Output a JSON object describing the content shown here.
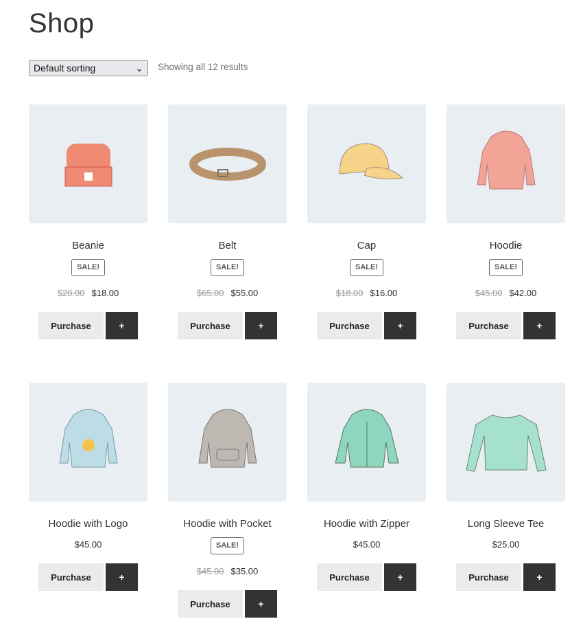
{
  "page": {
    "title": "Shop",
    "sorting": "Default sorting",
    "result_count": "Showing all 12 results"
  },
  "buttons": {
    "purchase": "Purchase",
    "plus": "+"
  },
  "products": [
    {
      "name": "Beanie",
      "sale": "SALE!",
      "old_price": "$20.00",
      "price": "$18.00",
      "color": "#f08a72"
    },
    {
      "name": "Belt",
      "sale": "SALE!",
      "old_price": "$65.00",
      "price": "$55.00",
      "color": "#b8936c"
    },
    {
      "name": "Cap",
      "sale": "SALE!",
      "old_price": "$18.00",
      "price": "$16.00",
      "color": "#f5d48a"
    },
    {
      "name": "Hoodie",
      "sale": "SALE!",
      "old_price": "$45.00",
      "price": "$42.00",
      "color": "#f2a497"
    },
    {
      "name": "Hoodie with Logo",
      "price": "$45.00",
      "color": "#bcdde8"
    },
    {
      "name": "Hoodie with Pocket",
      "sale": "SALE!",
      "old_price": "$45.00",
      "price": "$35.00",
      "color": "#bdb8b2"
    },
    {
      "name": "Hoodie with Zipper",
      "price": "$45.00",
      "color": "#8fd6c0"
    },
    {
      "name": "Long Sleeve Tee",
      "price": "$25.00",
      "color": "#a6e0cf"
    }
  ]
}
